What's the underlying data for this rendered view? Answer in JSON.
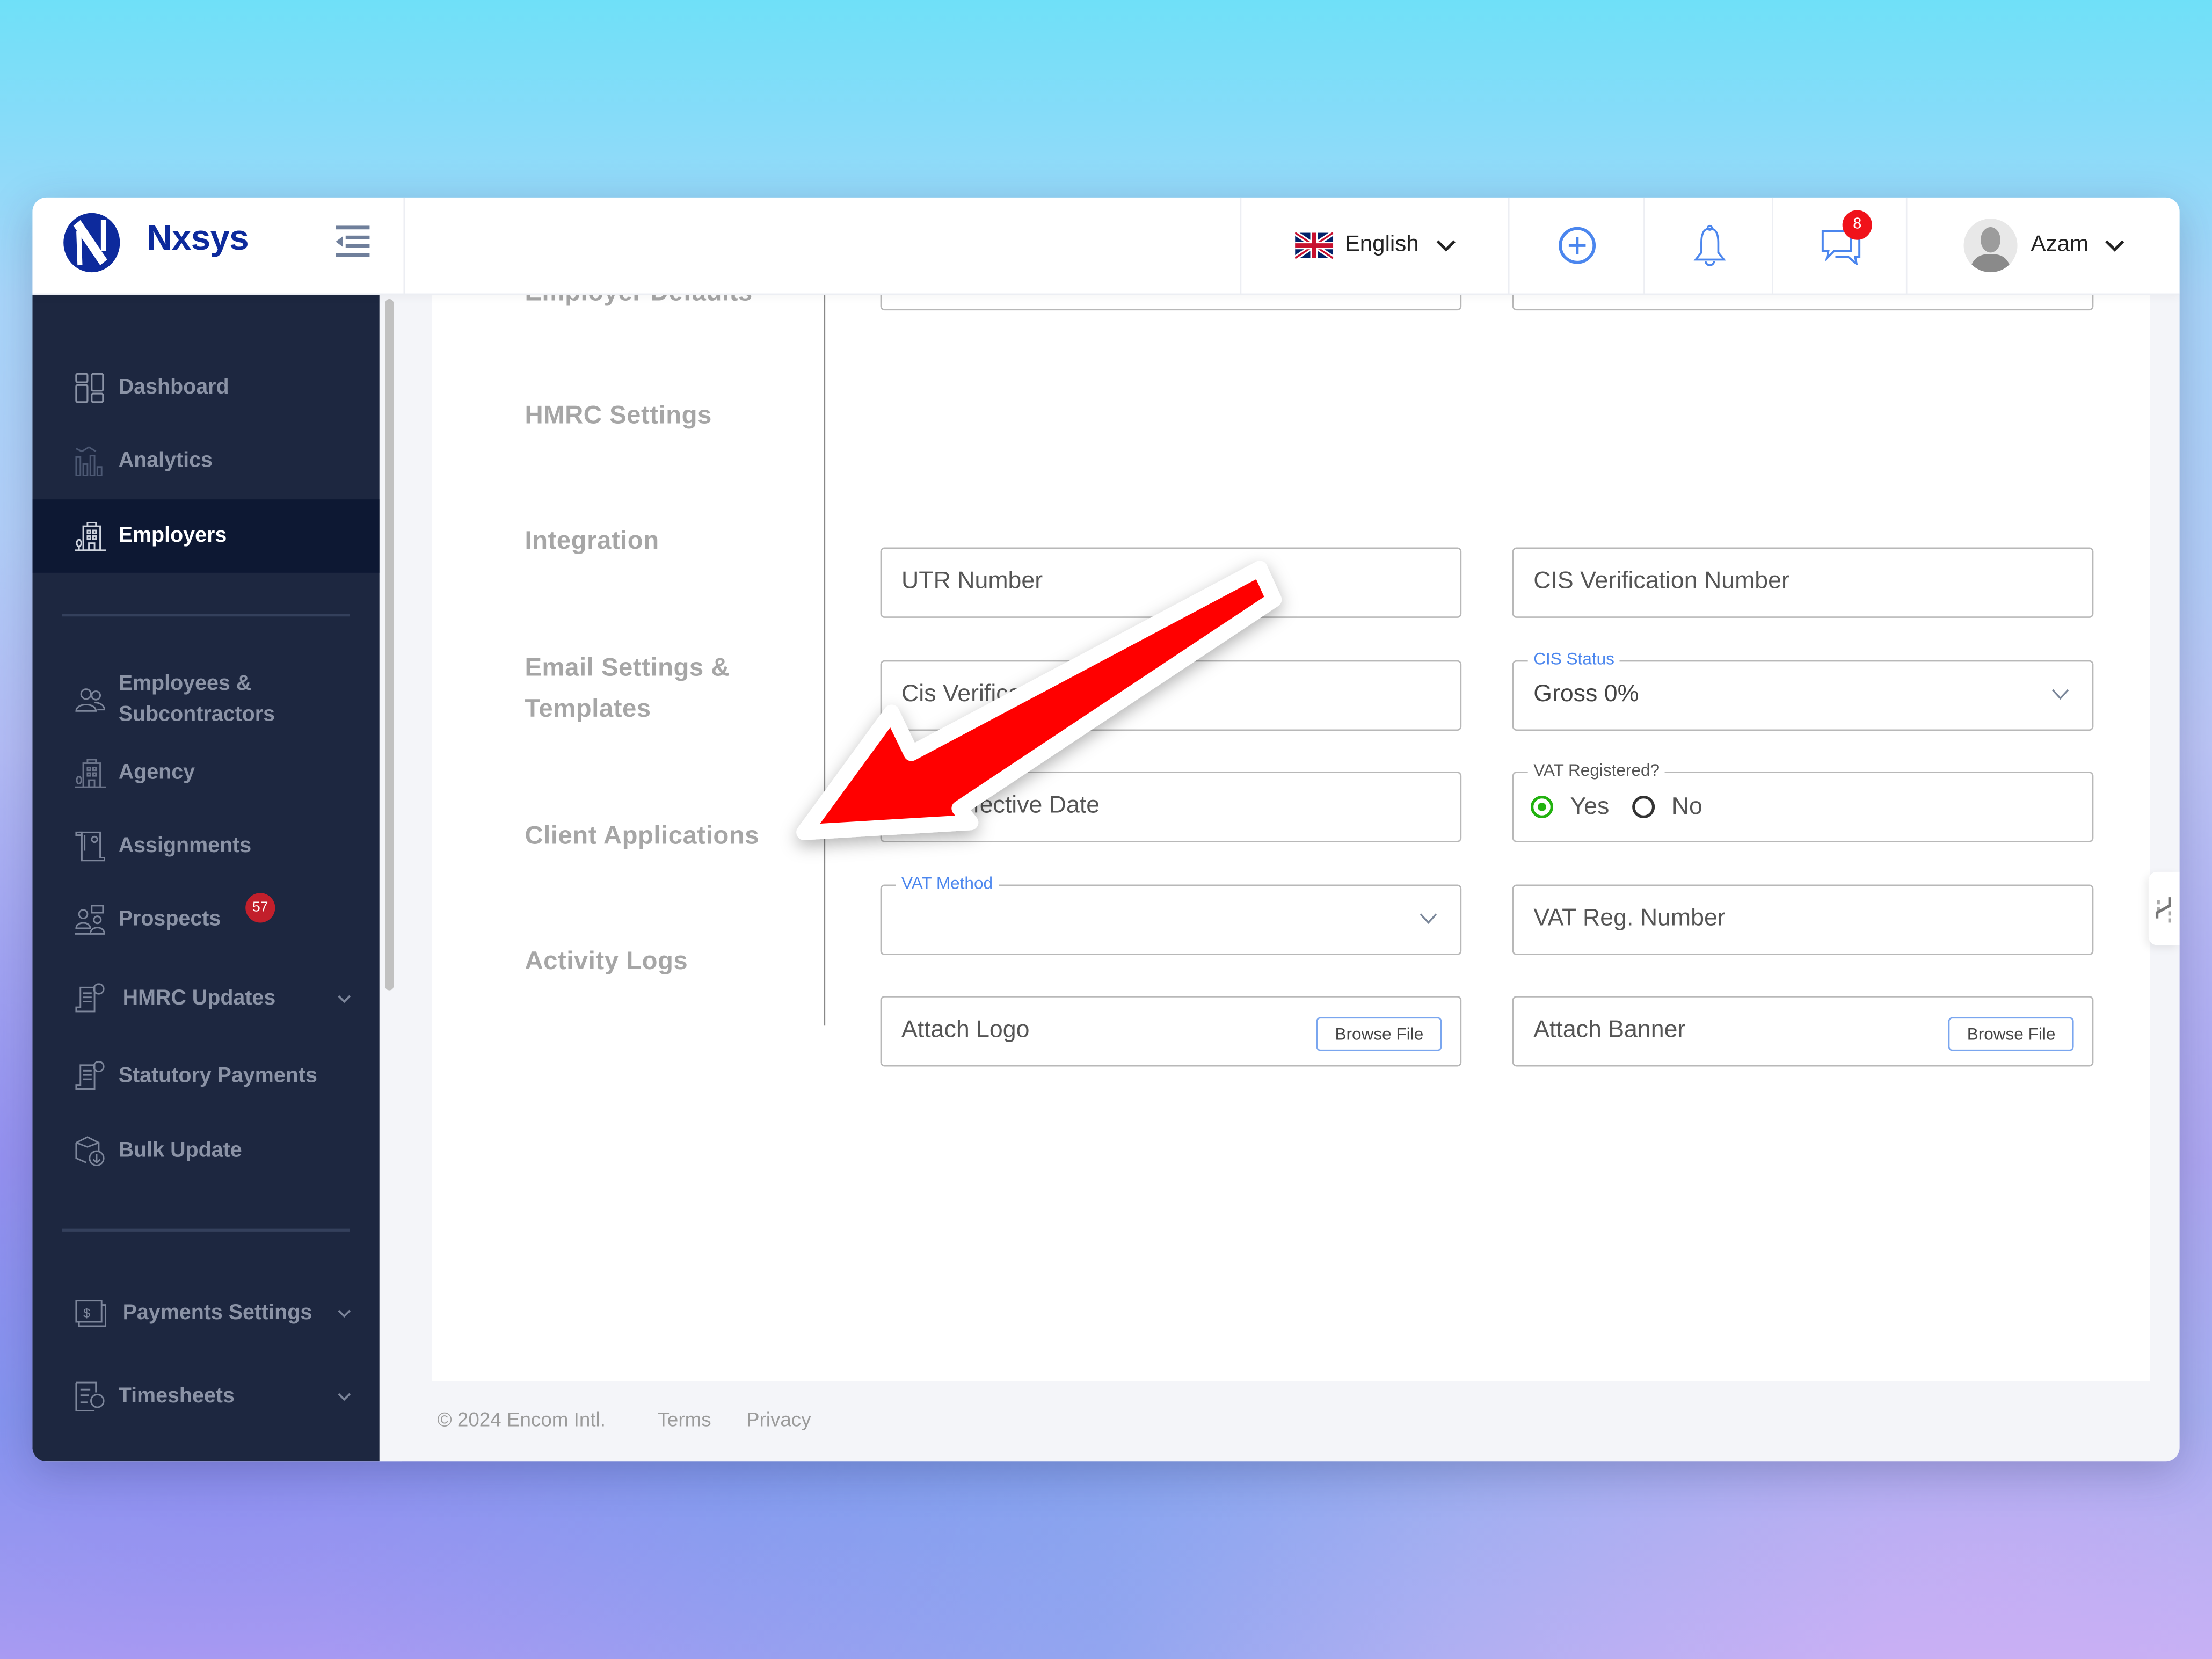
{
  "app": {
    "brand": "Nxsys"
  },
  "header": {
    "language": "English",
    "message_count": "8",
    "user_name": "Azam"
  },
  "sidebar": {
    "items": [
      {
        "label": "Dashboard",
        "icon": "dashboard-icon",
        "active": false
      },
      {
        "label": "Analytics",
        "icon": "analytics-icon",
        "active": false
      },
      {
        "label": "Employers",
        "icon": "building-icon",
        "active": true
      },
      {
        "label": "Employees & Subcontractors",
        "icon": "users-icon",
        "active": false
      },
      {
        "label": "Agency",
        "icon": "building-icon",
        "active": false
      },
      {
        "label": "Assignments",
        "icon": "assignment-icon",
        "active": false
      },
      {
        "label": "Prospects",
        "icon": "prospects-icon",
        "active": false,
        "badge": "57"
      },
      {
        "label": "HMRC Updates",
        "icon": "invoice-icon",
        "active": false,
        "expandable": true
      },
      {
        "label": "Statutory Payments",
        "icon": "invoice-icon",
        "active": false
      },
      {
        "label": "Bulk Update",
        "icon": "box-download-icon",
        "active": false
      },
      {
        "label": "Payments Settings",
        "icon": "payment-icon",
        "active": false,
        "expandable": true
      },
      {
        "label": "Timesheets",
        "icon": "timesheet-icon",
        "active": false,
        "expandable": true
      }
    ]
  },
  "sections": {
    "items": [
      "Employer Defaults",
      "HMRC Settings",
      "Integration",
      "Email Settings &",
      "Templates",
      "Client Applications",
      "Activity Logs"
    ]
  },
  "form": {
    "utr_number": "UTR Number",
    "cis_verification_number": "CIS Verification Number",
    "cis_verification_date": "Cis Verification Date",
    "cis_status_label": "CIS Status",
    "cis_status_value": "Gross 0%",
    "vat_effective_date": "VAT Effective Date",
    "vat_registered_label": "VAT Registered?",
    "vat_registered_yes": "Yes",
    "vat_registered_no": "No",
    "vat_registered_value": "Yes",
    "vat_method_label": "VAT Method",
    "vat_reg_number": "VAT Reg. Number",
    "attach_logo": "Attach Logo",
    "attach_banner": "Attach Banner",
    "browse_file": "Browse File"
  },
  "footer": {
    "copyright": "© 2024 Encom Intl.",
    "terms": "Terms",
    "privacy": "Privacy"
  },
  "colors": {
    "brand": "#0d2a9c",
    "sidebar_bg": "#1d2740",
    "sidebar_active": "#0d1833",
    "accent_blue": "#4b86ee",
    "radio_selected": "#22b20f",
    "badge_red": "#f0121a",
    "annotation_arrow": "#ff0000"
  }
}
